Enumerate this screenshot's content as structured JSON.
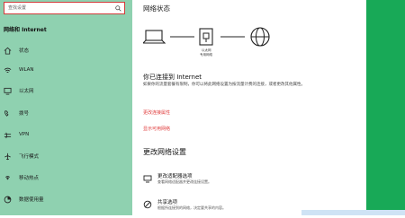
{
  "sidebar": {
    "search_placeholder": "查找设置",
    "home_label": "网络和 Internet",
    "items": [
      {
        "label": "状态",
        "icon": "home-icon"
      },
      {
        "label": "WLAN",
        "icon": "wifi-icon"
      },
      {
        "label": "以太网",
        "icon": "ethernet-icon"
      },
      {
        "label": "拨号",
        "icon": "dialup-icon"
      },
      {
        "label": "VPN",
        "icon": "vpn-icon"
      },
      {
        "label": "飞行模式",
        "icon": "airplane-icon"
      },
      {
        "label": "移动热点",
        "icon": "hotspot-icon"
      },
      {
        "label": "数据使用量",
        "icon": "data-usage-icon"
      }
    ]
  },
  "main": {
    "title": "网络状态",
    "diagram_label_1": "以太网",
    "diagram_label_2": "专用网络",
    "status_heading": "你已连接到 Internet",
    "status_description": "如果你的流量套餐有限制，你可以将此网络设置为按流量计费的连接，或者更改其他属性。",
    "link_change_properties": "更改连接属性",
    "link_show_networks": "显示可用网络",
    "section_heading": "更改网络设置",
    "options": [
      {
        "title": "更改适配器选项",
        "desc": "查看网络适配器并更改连接设置。",
        "icon": "adapter-icon"
      },
      {
        "title": "共享选项",
        "desc": "根据所连接到的网络，决定要共享的内容。",
        "icon": "share-icon"
      }
    ]
  },
  "colors": {
    "sidebar_bg": "#8fd1b0",
    "link": "#e03c3c",
    "side_green": "#18a957"
  }
}
